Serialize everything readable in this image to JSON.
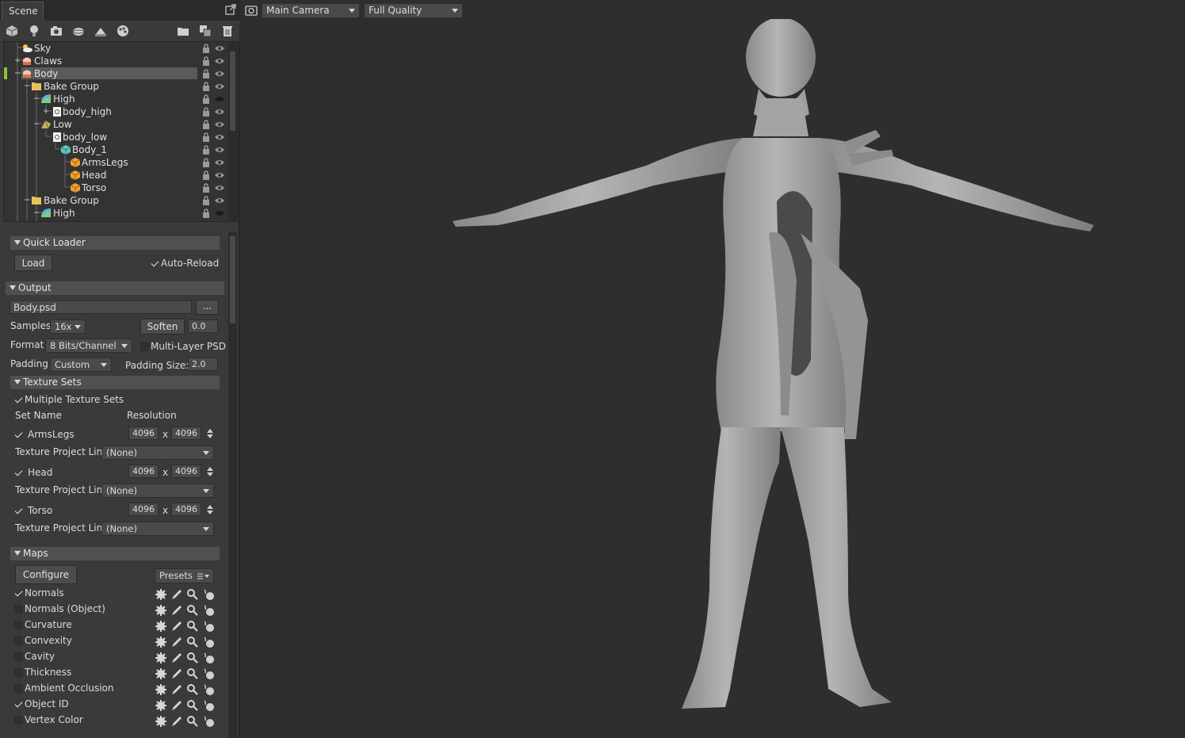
{
  "scene": {
    "tab_title": "Scene",
    "tree": [
      {
        "label": "Sky",
        "icon": "sky-icon",
        "depth": 1
      },
      {
        "label": "Claws",
        "icon": "mesh-icon",
        "depth": 1
      },
      {
        "label": "Body",
        "icon": "mesh-icon",
        "depth": 1,
        "selected": true
      },
      {
        "label": "Bake Group",
        "icon": "folder-icon",
        "depth": 2
      },
      {
        "label": "High",
        "icon": "high-icon",
        "depth": 3
      },
      {
        "label": "body_high",
        "icon": "file-icon",
        "depth": 4
      },
      {
        "label": "Low",
        "icon": "low-icon",
        "depth": 3
      },
      {
        "label": "body_low",
        "icon": "file-icon",
        "depth": 4
      },
      {
        "label": "Body_1",
        "icon": "cube-icon",
        "depth": 5
      },
      {
        "label": "ArmsLegs",
        "icon": "material-icon",
        "depth": 6
      },
      {
        "label": "Head",
        "icon": "material-icon",
        "depth": 6
      },
      {
        "label": "Torso",
        "icon": "material-icon",
        "depth": 6
      },
      {
        "label": "Bake Group",
        "icon": "folder-icon",
        "depth": 2
      },
      {
        "label": "High",
        "icon": "high-icon",
        "depth": 3
      }
    ]
  },
  "quick_loader": {
    "title": "Quick Loader",
    "load_label": "Load",
    "auto_reload_label": "Auto-Reload"
  },
  "output": {
    "title": "Output",
    "filename": "Body.psd",
    "browse_label": "...",
    "samples_label": "Samples",
    "samples_value": "16x",
    "soften_label": "Soften",
    "soften_value": "0.0",
    "format_label": "Format",
    "format_value": "8 Bits/Channel",
    "multilayer_label": "Multi-Layer PSD",
    "padding_label": "Padding",
    "padding_value": "Custom",
    "padding_size_label": "Padding Size:",
    "padding_size_value": "2.0"
  },
  "texture_sets": {
    "title": "Texture Sets",
    "multiple_label": "Multiple Texture Sets",
    "col_set_name": "Set Name",
    "col_resolution": "Resolution",
    "x_label": "x",
    "link_label": "Texture Project Link",
    "sets": [
      {
        "name": "ArmsLegs",
        "w": "4096",
        "h": "4096",
        "link": "(None)"
      },
      {
        "name": "Head",
        "w": "4096",
        "h": "4096",
        "link": "(None)"
      },
      {
        "name": "Torso",
        "w": "4096",
        "h": "4096",
        "link": "(None)"
      }
    ]
  },
  "maps": {
    "title": "Maps",
    "configure_label": "Configure",
    "presets_label": "Presets",
    "items": [
      {
        "label": "Normals",
        "checked": true
      },
      {
        "label": "Normals (Object)",
        "checked": false
      },
      {
        "label": "Curvature",
        "checked": false
      },
      {
        "label": "Convexity",
        "checked": false
      },
      {
        "label": "Cavity",
        "checked": false
      },
      {
        "label": "Thickness",
        "checked": false
      },
      {
        "label": "Ambient Occlusion",
        "checked": false
      },
      {
        "label": "Object ID",
        "checked": true
      },
      {
        "label": "Vertex Color",
        "checked": false
      }
    ]
  },
  "viewport": {
    "camera_value": "Main Camera",
    "quality_value": "Full Quality"
  },
  "colors": {
    "panel_bg": "#3a3a3a",
    "viewport_bg": "#2e2e2e",
    "section_header": "#505050",
    "selection": "#5a5a5a",
    "accent_green": "#8fc23c"
  }
}
